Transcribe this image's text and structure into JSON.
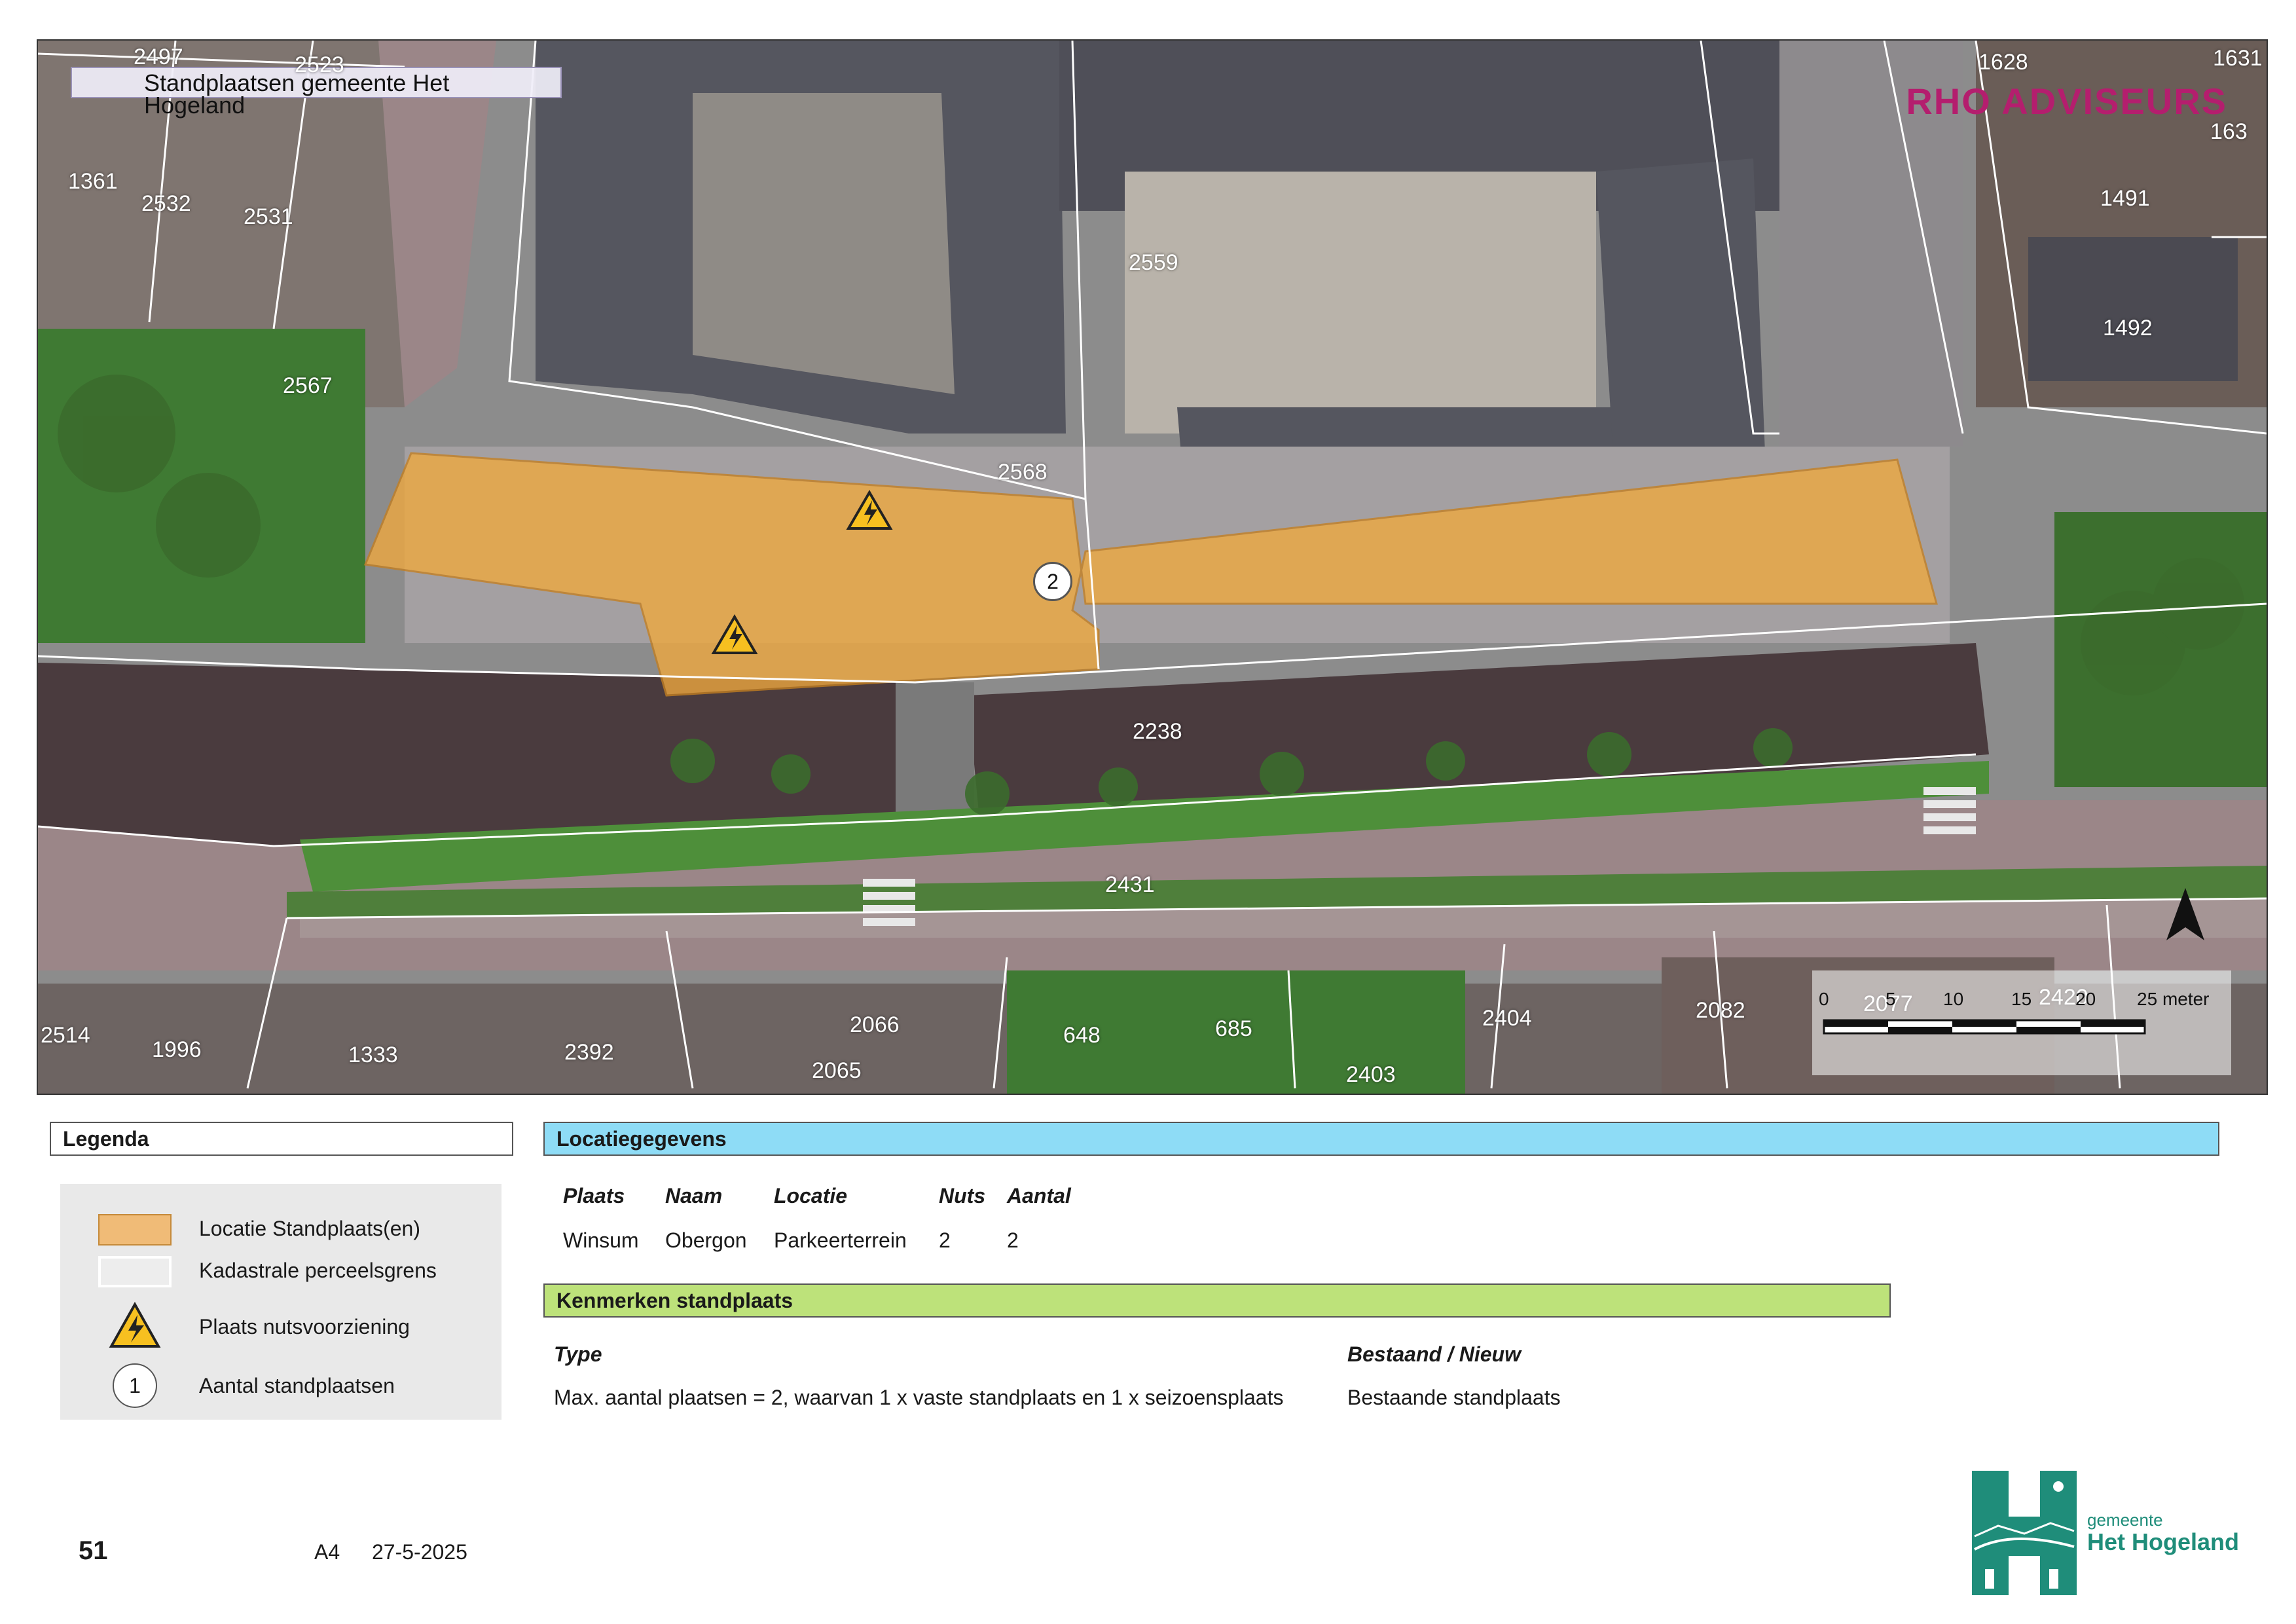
{
  "map": {
    "title": "Standplaatsen gemeente Het Hogeland",
    "watermark": "RHO ADVISEURS",
    "parcels": [
      {
        "label": "2497"
      },
      {
        "label": "2523"
      },
      {
        "label": "1361"
      },
      {
        "label": "2532"
      },
      {
        "label": "2531"
      },
      {
        "label": "2567"
      },
      {
        "label": "2559"
      },
      {
        "label": "2568"
      },
      {
        "label": "1628"
      },
      {
        "label": "1631"
      },
      {
        "label": "163"
      },
      {
        "label": "1491"
      },
      {
        "label": "1492"
      },
      {
        "label": "2238"
      },
      {
        "label": "2431"
      },
      {
        "label": "2514"
      },
      {
        "label": "1996"
      },
      {
        "label": "1333"
      },
      {
        "label": "2392"
      },
      {
        "label": "2066"
      },
      {
        "label": "2065"
      },
      {
        "label": "648"
      },
      {
        "label": "685"
      },
      {
        "label": "2404"
      },
      {
        "label": "2403"
      },
      {
        "label": "2082"
      },
      {
        "label": "2077"
      },
      {
        "label": "2420"
      }
    ],
    "location_marker": "2",
    "scale": {
      "ticks": [
        "0",
        "5",
        "10",
        "15",
        "20"
      ],
      "last": "25",
      "unit": "meter"
    },
    "colors": {
      "location_fill": "#f0a93e",
      "parcel_line": "#ffffff",
      "water": "#4a3b3e",
      "grass": "#4e8f3a",
      "road": "#9b8688"
    }
  },
  "legend": {
    "title": "Legenda",
    "items": [
      {
        "label": "Locatie Standplaats(en)",
        "icon": "orange-swatch"
      },
      {
        "label": "Kadastrale perceelsgrens",
        "icon": "parcel-boundary-swatch"
      },
      {
        "label": "Plaats nutsvoorziening",
        "icon": "electricity-warning-icon"
      },
      {
        "label": "Aantal standplaatsen",
        "icon": "number-circle",
        "marker": "1"
      }
    ]
  },
  "locatiegegevens": {
    "title": "Locatiegegevens",
    "headers": [
      "Plaats",
      "Naam",
      "Locatie",
      "Nuts",
      "Aantal"
    ],
    "values": [
      "Winsum",
      "Obergon",
      "Parkeerterrein",
      "2",
      "2"
    ]
  },
  "kenmerken": {
    "title": "Kenmerken standplaats",
    "type_header": "Type",
    "status_header": "Bestaand / Nieuw",
    "type_value": "Max. aantal plaatsen = 2, waarvan 1 x vaste standplaats en 1 x seizoensplaats",
    "status_value": "Bestaande standplaats"
  },
  "footer": {
    "page_number": "51",
    "paper_size": "A4",
    "date": "27-5-2025"
  },
  "logo": {
    "line1": "gemeente",
    "line2": "Het Hogeland"
  }
}
